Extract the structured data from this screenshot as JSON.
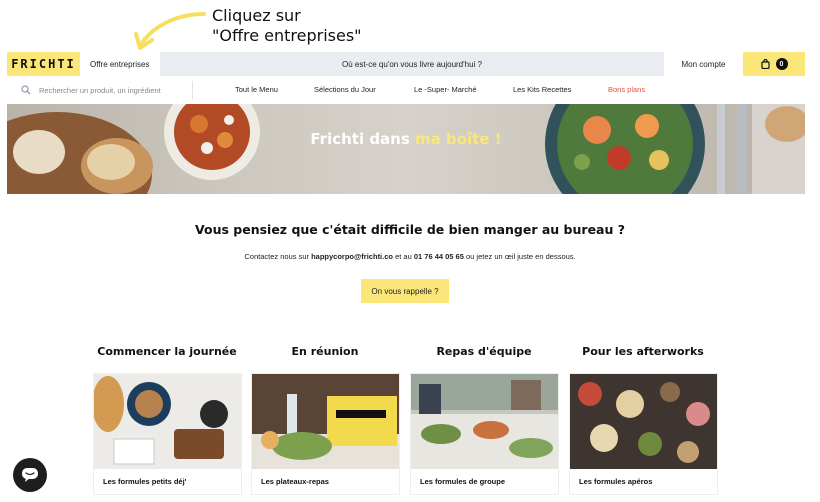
{
  "annotation": {
    "line1": "Cliquez sur",
    "line2": "\"Offre entreprises\""
  },
  "header": {
    "logo": "FRICHTI",
    "offre_link": "Offre entreprises",
    "delivery_prompt": "Où est-ce qu'on vous livre aujourd'hui ?",
    "account": "Mon compte",
    "cart_count": "0"
  },
  "nav": {
    "search_placeholder": "Rechercher un produit, un ingrédient",
    "items": [
      "Tout le Menu",
      "Sélections du Jour",
      "Le -Super- Marché",
      "Les Kits Recettes",
      "Bons plans"
    ]
  },
  "banner": {
    "title_prefix": "Frichti dans ",
    "title_highlight": "ma boîte !"
  },
  "main": {
    "headline": "Vous pensiez que c'était difficile de bien manger au bureau ?",
    "contact_prefix": "Contactez nous sur ",
    "contact_email": "happycorpo@frichti.co",
    "contact_middle": " et au ",
    "contact_phone": "01 76 44 05 65",
    "contact_suffix": " ou jetez un œil juste en dessous.",
    "callback_button": "On vous rappelle ?"
  },
  "categories": [
    {
      "title": "Commencer la journée",
      "card_label": "Les formules petits déj'"
    },
    {
      "title": "En réunion",
      "card_label": "Les plateaux-repas"
    },
    {
      "title": "Repas d'équipe",
      "card_label": "Les formules de groupe"
    },
    {
      "title": "Pour les afterworks",
      "card_label": "Les formules apéros"
    }
  ],
  "colors": {
    "accent_yellow": "#fbe67a",
    "promo_red": "#e0523a",
    "delivery_bar": "#e9edf2"
  },
  "icons": {
    "search": "search-icon",
    "cart": "bag-icon",
    "chat": "chat-icon",
    "arrow": "annotation-arrow-icon"
  }
}
